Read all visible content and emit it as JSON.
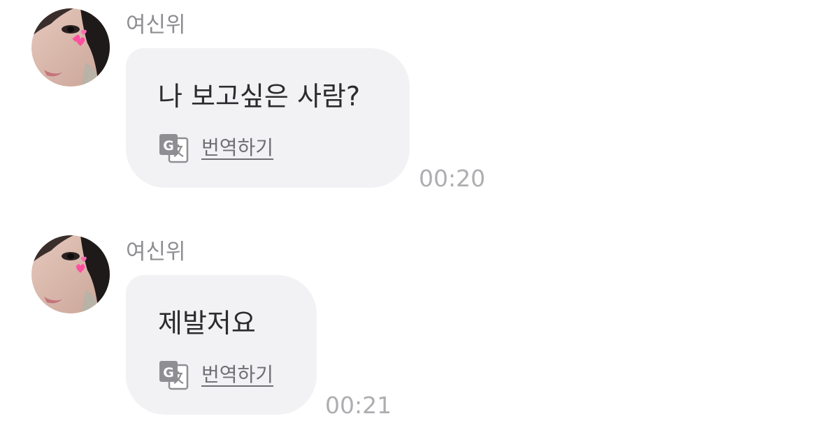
{
  "messages": [
    {
      "sender": "여신위",
      "avatar": "profile-photo",
      "text": "나 보고싶은 사람?",
      "translate_label": "번역하기",
      "translate_icon": "google-translate-icon",
      "time": "00:20"
    },
    {
      "sender": "여신위",
      "avatar": "profile-photo",
      "text": "제발저요",
      "translate_label": "번역하기",
      "translate_icon": "google-translate-icon",
      "time": "00:21"
    }
  ],
  "colors": {
    "bubble": "#f2f2f5",
    "sender": "#8e8e93",
    "message_text": "#2c2c2e",
    "translate": "#6e6e73",
    "time": "#aeaeb2",
    "heart": "#ff4fa0"
  }
}
